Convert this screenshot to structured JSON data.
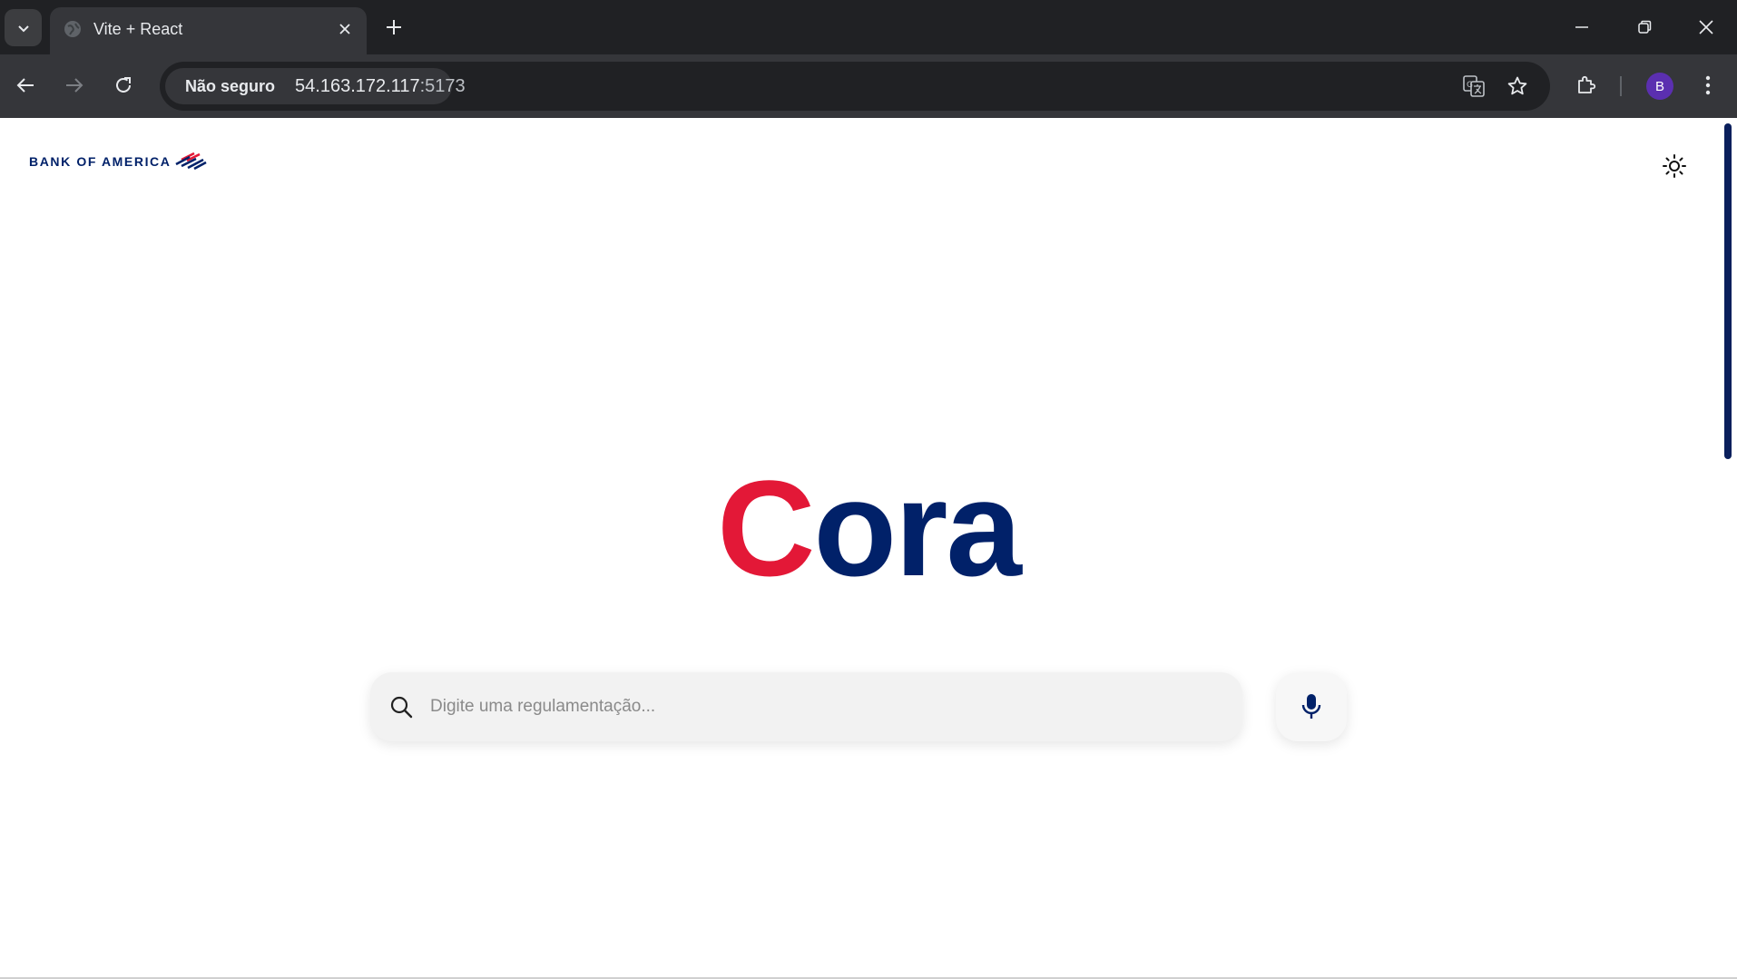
{
  "browser": {
    "tab": {
      "title": "Vite + React"
    },
    "address_bar": {
      "security_label": "Não seguro",
      "url_host": "54.163.172.117",
      "url_port": ":5173"
    },
    "profile_initial": "B"
  },
  "page": {
    "logo_text": "BANK OF AMERICA",
    "title_first_letter": "C",
    "title_rest": "ora",
    "search": {
      "placeholder": "Digite uma regulamentação..."
    }
  },
  "colors": {
    "brand_red": "#e31837",
    "brand_navy": "#012169",
    "chrome_dark": "#202124",
    "chrome_toolbar": "#35363a"
  },
  "icons": {
    "theme_toggle": "sun-icon",
    "search": "search-icon",
    "voice": "microphone-icon"
  }
}
